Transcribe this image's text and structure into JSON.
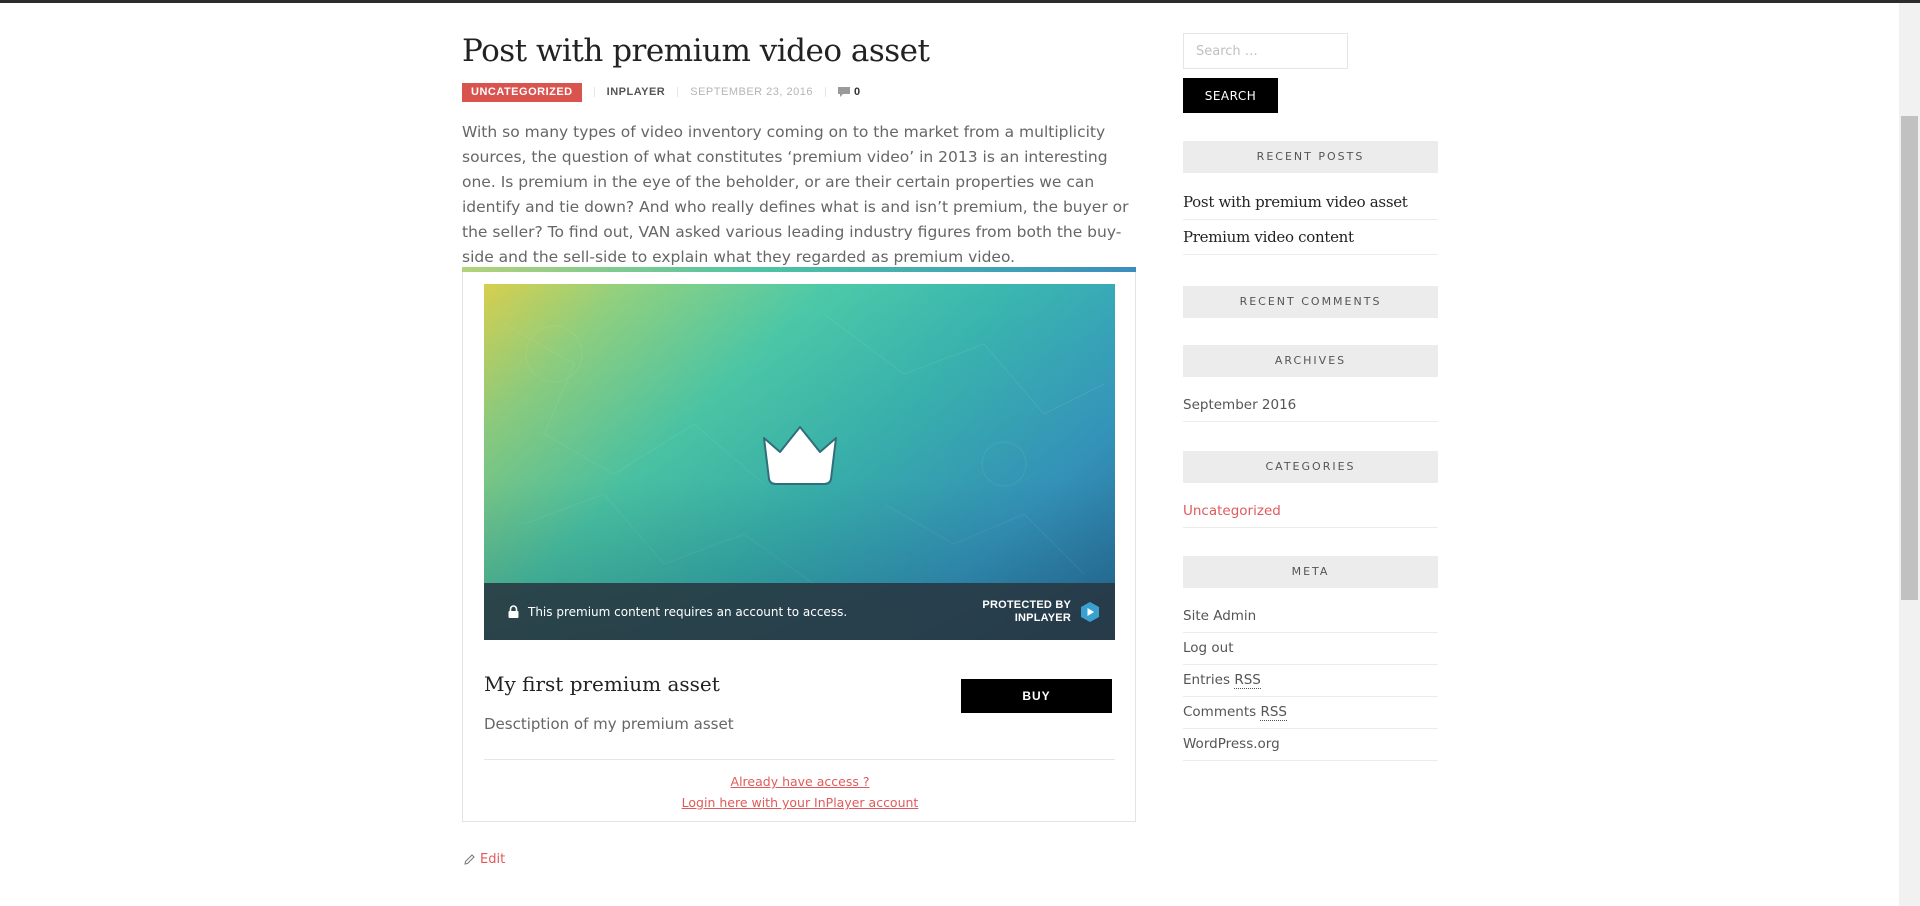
{
  "post": {
    "title": "Post with premium video asset",
    "category": "Uncategorized",
    "author": "InPlayer",
    "date": "September 23, 2016",
    "comment_count": "0",
    "excerpt": "With so many types of video inventory coming on to the market from a multiplicity sources, the question of what constitutes ‘premium video’ in 2013 is an interesting one. Is premium in the eye of the beholder, or are their certain properties we can identify and tie down? And who really defines what is and isn’t premium, the buyer or the seller? To find out, VAN asked various leading industry figures from both the buy-side and the sell-side to explain what they regarded as premium video.",
    "edit_label": "Edit"
  },
  "asset": {
    "lock_message": "This premium content requires an account to access.",
    "protected_line1": "PROTECTED BY",
    "protected_line2": "INPLAYER",
    "title": "My first premium asset",
    "description": "Desctiption of my premium asset",
    "buy_label": "BUY",
    "already_access": "Already have access ?",
    "login_link": "Login here with your InPlayer account"
  },
  "sidebar": {
    "search_placeholder": "Search …",
    "search_button": "SEARCH",
    "recent_posts_title": "Recent Posts",
    "recent_posts": [
      "Post with premium video asset",
      "Premium video content"
    ],
    "recent_comments_title": "Recent Comments",
    "archives_title": "Archives",
    "archives": [
      "September 2016"
    ],
    "categories_title": "Categories",
    "categories": [
      "Uncategorized"
    ],
    "meta_title": "Meta",
    "meta": {
      "site_admin": "Site Admin",
      "log_out": "Log out",
      "entries": "Entries",
      "comments": "Comments",
      "rss": "RSS",
      "wordpress": "WordPress.org"
    }
  },
  "colors": {
    "accent": "#d9534f",
    "link": "#e05a5a",
    "button": "#000000"
  }
}
